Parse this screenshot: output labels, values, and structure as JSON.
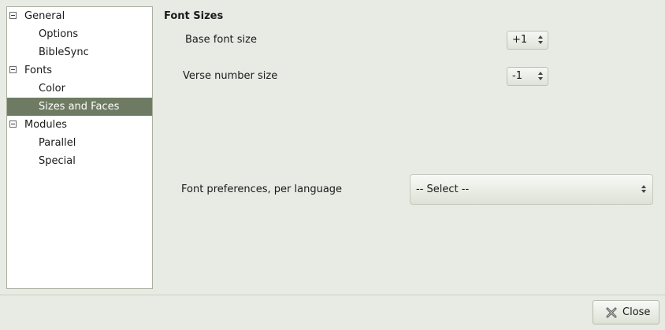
{
  "tree": {
    "items": [
      {
        "label": "General",
        "level": "parent",
        "expanded": true
      },
      {
        "label": "Options",
        "level": "child"
      },
      {
        "label": "BibleSync",
        "level": "child"
      },
      {
        "label": "Fonts",
        "level": "parent",
        "expanded": true
      },
      {
        "label": "Color",
        "level": "child"
      },
      {
        "label": "Sizes and Faces",
        "level": "child",
        "selected": true
      },
      {
        "label": "Modules",
        "level": "parent",
        "expanded": true
      },
      {
        "label": "Parallel",
        "level": "child"
      },
      {
        "label": "Special",
        "level": "child"
      }
    ]
  },
  "main": {
    "section_title": "Font Sizes",
    "base_font": {
      "label": "Base font size",
      "value": "+1"
    },
    "verse_number": {
      "label": "Verse number size",
      "value": "-1"
    },
    "font_prefs": {
      "label": "Font preferences, per language",
      "value": "-- Select --"
    }
  },
  "footer": {
    "close_label": "Close"
  },
  "colors": {
    "selected_bg": "#6e7b62",
    "window_bg": "#e8ebe4"
  }
}
